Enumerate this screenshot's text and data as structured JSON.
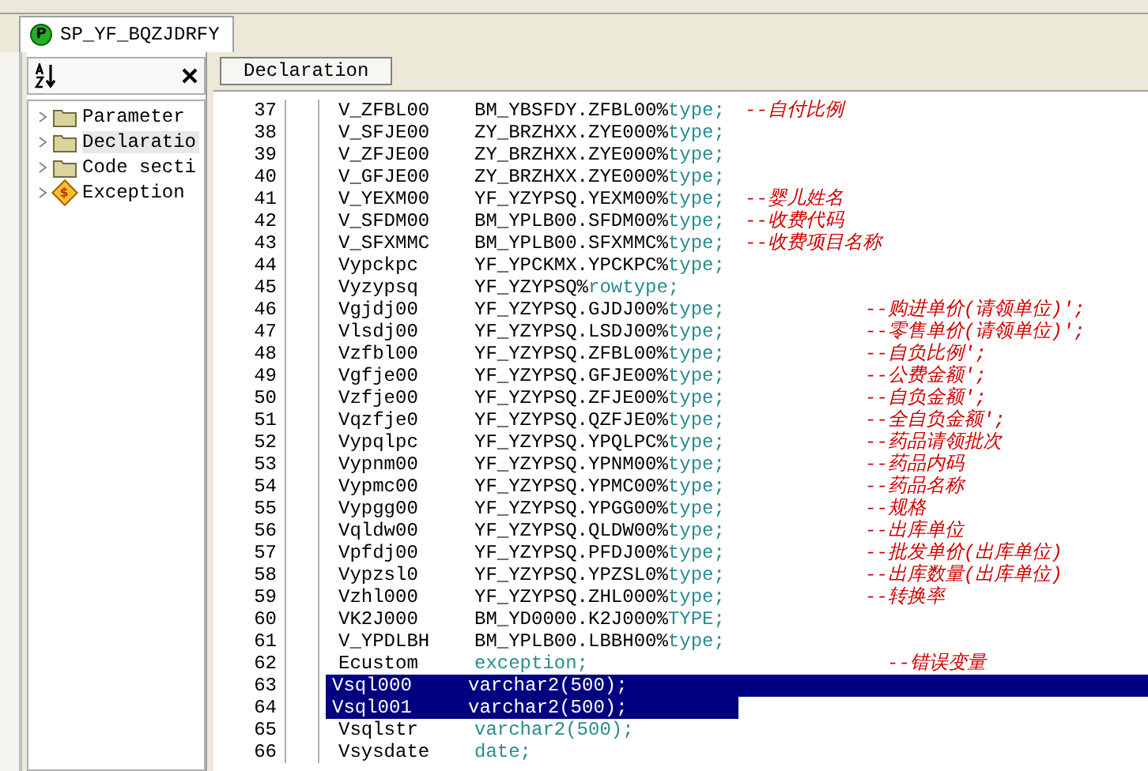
{
  "document_tab": {
    "icon": "P",
    "title": "SP_YF_BQZJDRFY",
    "selected": true
  },
  "outline": {
    "items": [
      {
        "label": "Parameter",
        "kind": "folder",
        "selected": false
      },
      {
        "label": "Declaratio",
        "kind": "folder",
        "selected": true
      },
      {
        "label": "Code secti",
        "kind": "folder",
        "selected": false
      },
      {
        "label": "Exception",
        "kind": "exception",
        "icon": "$",
        "selected": false
      }
    ]
  },
  "editor": {
    "section_tab": "Declaration",
    "lines": [
      {
        "number": "37",
        "name": "V_ZFBL00",
        "ref": "BM_YBSFDY.ZFBL00%",
        "type": "type;",
        "comment": "--自付比例",
        "kind": "near",
        "selected": false
      },
      {
        "number": "38",
        "name": "V_SFJE00",
        "ref": "ZY_BRZHXX.ZYE000%",
        "type": "type;",
        "selected": false
      },
      {
        "number": "39",
        "name": "V_ZFJE00",
        "ref": "ZY_BRZHXX.ZYE000%",
        "type": "type;",
        "selected": false
      },
      {
        "number": "40",
        "name": "V_GFJE00",
        "ref": "ZY_BRZHXX.ZYE000%",
        "type": "type;",
        "selected": false
      },
      {
        "number": "41",
        "name": "V_YEXM00",
        "ref": "YF_YZYPSQ.YEXM00%",
        "type": "type;",
        "comment": "--婴儿姓名",
        "kind": "near",
        "selected": false
      },
      {
        "number": "42",
        "name": "V_SFDM00",
        "ref": "BM_YPLB00.SFDM00%",
        "type": "type;",
        "comment": "--收费代码",
        "kind": "near",
        "selected": false
      },
      {
        "number": "43",
        "name": "V_SFXMMC",
        "ref": "BM_YPLB00.SFXMMC%",
        "type": "type;",
        "comment": "--收费项目名称",
        "kind": "near",
        "selected": false
      },
      {
        "number": "44",
        "name": "Vypckpc",
        "ref": "YF_YPCKMX.YPCKPC%",
        "type": "type;",
        "selected": false
      },
      {
        "number": "45",
        "name": "Vyzypsq",
        "ref": "YF_YZYPSQ%",
        "type": "rowtype;",
        "selected": false
      },
      {
        "number": "46",
        "name": "Vgjdj00",
        "ref": "YF_YZYPSQ.GJDJ00%",
        "type": "type;",
        "comment": "--购进单价(请领单位)';",
        "kind": "far",
        "selected": false
      },
      {
        "number": "47",
        "name": "Vlsdj00",
        "ref": "YF_YZYPSQ.LSDJ00%",
        "type": "type;",
        "comment": "--零售单价(请领单位)';",
        "kind": "far",
        "selected": false
      },
      {
        "number": "48",
        "name": "Vzfbl00",
        "ref": "YF_YZYPSQ.ZFBL00%",
        "type": "type;",
        "comment": "--自负比例';",
        "kind": "far",
        "selected": false
      },
      {
        "number": "49",
        "name": "Vgfje00",
        "ref": "YF_YZYPSQ.GFJE00%",
        "type": "type;",
        "comment": "--公费金额';",
        "kind": "far",
        "selected": false
      },
      {
        "number": "50",
        "name": "Vzfje00",
        "ref": "YF_YZYPSQ.ZFJE00%",
        "type": "type;",
        "comment": "--自负金额';",
        "kind": "far",
        "selected": false
      },
      {
        "number": "51",
        "name": "Vqzfje0",
        "ref": "YF_YZYPSQ.QZFJE0%",
        "type": "type;",
        "comment": "--全自负金额';",
        "kind": "far",
        "selected": false
      },
      {
        "number": "52",
        "name": "Vypqlpc",
        "ref": "YF_YZYPSQ.YPQLPC%",
        "type": "type;",
        "comment": "--药品请领批次",
        "kind": "far",
        "selected": false
      },
      {
        "number": "53",
        "name": "Vypnm00",
        "ref": "YF_YZYPSQ.YPNM00%",
        "type": "type;",
        "comment": "--药品内码",
        "kind": "far",
        "selected": false
      },
      {
        "number": "54",
        "name": "Vypmc00",
        "ref": "YF_YZYPSQ.YPMC00%",
        "type": "type;",
        "comment": "--药品名称",
        "kind": "far",
        "selected": false
      },
      {
        "number": "55",
        "name": "Vypgg00",
        "ref": "YF_YZYPSQ.YPGG00%",
        "type": "type;",
        "comment": "--规格",
        "kind": "far",
        "selected": false
      },
      {
        "number": "56",
        "name": "Vqldw00",
        "ref": "YF_YZYPSQ.QLDW00%",
        "type": "type;",
        "comment": "--出库单位",
        "kind": "far",
        "selected": false
      },
      {
        "number": "57",
        "name": "Vpfdj00",
        "ref": "YF_YZYPSQ.PFDJ00%",
        "type": "type;",
        "comment": "--批发单价(出库单位)",
        "kind": "far",
        "selected": false
      },
      {
        "number": "58",
        "name": "Vypzsl0",
        "ref": "YF_YZYPSQ.YPZSL0%",
        "type": "type;",
        "comment": "--出库数量(出库单位)",
        "kind": "far",
        "selected": false
      },
      {
        "number": "59",
        "name": "Vzhl000",
        "ref": "YF_YZYPSQ.ZHL000%",
        "type": "type;",
        "comment": "--转换率",
        "kind": "far",
        "selected": false
      },
      {
        "number": "60",
        "name": "VK2J000",
        "ref": "BM_YD0000.K2J000%",
        "type": "TYPE;",
        "selected": false
      },
      {
        "number": "61",
        "name": "V_YPDLBH",
        "ref": "BM_YPLB00.LBBH00%",
        "type": "type;",
        "selected": false
      },
      {
        "number": "62",
        "name": "Ecustom",
        "type": "exception;",
        "comment": "--错误变量",
        "kind": "farther",
        "selected": false
      },
      {
        "number": "63",
        "name": "Vsql000",
        "type": "varchar2(500);",
        "selected": true
      },
      {
        "number": "64",
        "name": "Vsql001",
        "type": "varchar2(500);",
        "selected": true
      },
      {
        "number": "65",
        "name": "Vsqlstr",
        "type": "varchar2(500);",
        "selected": false
      },
      {
        "number": "66",
        "name": "Vsysdate",
        "type": "date;",
        "selected": false
      }
    ]
  }
}
